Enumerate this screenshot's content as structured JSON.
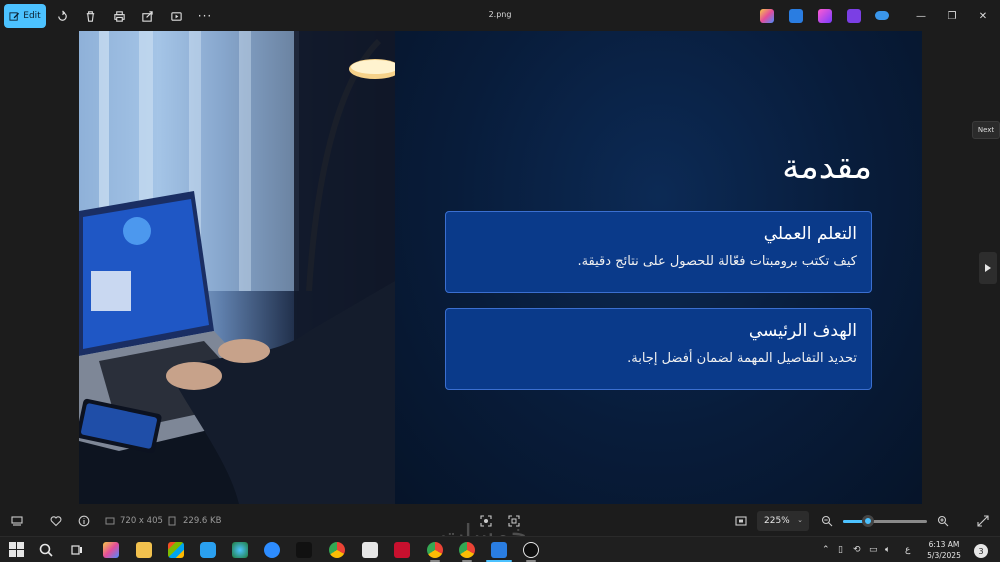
{
  "toolbar": {
    "edit_label": "Edit",
    "file_title": "2.png"
  },
  "slide": {
    "title": "مقدمة",
    "cards": [
      {
        "heading": "التعلم العملي",
        "text": "كيف تكتب برومبتات فعّالة للحصول على نتائج دقيقة."
      },
      {
        "heading": "الهدف الرئيسي",
        "text": "تحديد التفاصيل المهمة لضمان أفضل إجابة."
      }
    ]
  },
  "navigation": {
    "next_tooltip": "Next"
  },
  "info": {
    "dimensions": "720 x 405",
    "file_size": "229.6 KB",
    "zoom_value": "225%",
    "zoom_fraction": 0.3
  },
  "taskbar": {
    "time": "6:13 AM",
    "date": "5/3/2025",
    "language": "ع",
    "notification_count": "3"
  },
  "watermark": "خمسات",
  "colors": {
    "accent": "#4cc2ff",
    "card_bg": "#0a3a8a",
    "slide_bg": "#081c3a"
  }
}
